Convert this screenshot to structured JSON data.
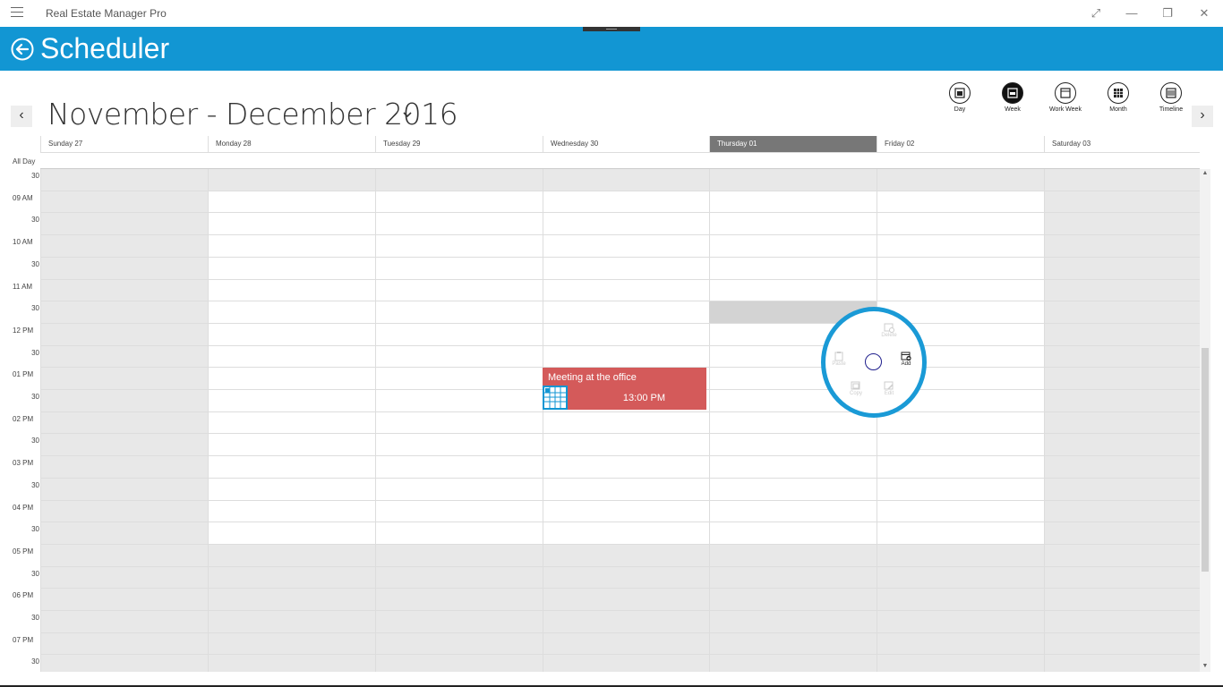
{
  "app": {
    "title": "Real Estate Manager Pro"
  },
  "window_controls": {
    "fullscreen": "⤢",
    "minimize": "—",
    "restore": "❐",
    "close": "✕"
  },
  "header": {
    "title": "Scheduler",
    "accent": "#1296d3"
  },
  "toolbar": {
    "range_title": "November - December 2016",
    "prev": "‹",
    "next": "›",
    "views": [
      {
        "label": "Day",
        "active": false
      },
      {
        "label": "Week",
        "active": true
      },
      {
        "label": "Work Week",
        "active": false
      },
      {
        "label": "Month",
        "active": false
      },
      {
        "label": "Timeline",
        "active": false
      }
    ]
  },
  "days": [
    {
      "label": "Sunday 27",
      "weekend": true,
      "today": false
    },
    {
      "label": "Monday 28",
      "weekend": false,
      "today": false
    },
    {
      "label": "Tuesday 29",
      "weekend": false,
      "today": false
    },
    {
      "label": "Wednesday 30",
      "weekend": false,
      "today": false
    },
    {
      "label": "Thursday 01",
      "weekend": false,
      "today": true
    },
    {
      "label": "Friday 02",
      "weekend": false,
      "today": false
    },
    {
      "label": "Saturday 03",
      "weekend": true,
      "today": false
    }
  ],
  "all_day_label": "All Day",
  "time_labels": [
    "30",
    "09 AM",
    "30",
    "10 AM",
    "30",
    "11 AM",
    "30",
    "12 PM",
    "30",
    "01 PM",
    "30",
    "02 PM",
    "30",
    "03 PM",
    "30",
    "04 PM",
    "30",
    "05 PM",
    "30",
    "06 PM",
    "30",
    "07 PM",
    "30"
  ],
  "event": {
    "title": "Meeting at the office",
    "time": "13:00 PM",
    "color": "#d45a5a"
  },
  "radial_menu": {
    "items": [
      {
        "label": "Delete",
        "enabled": false
      },
      {
        "label": "Add",
        "enabled": true
      },
      {
        "label": "Paste",
        "enabled": false
      },
      {
        "label": "Copy",
        "enabled": false
      },
      {
        "label": "Edit",
        "enabled": false
      }
    ]
  },
  "colors": {
    "off_hours": "#e8e8e8",
    "work_hours": "#ffffff",
    "today_header": "#777777"
  }
}
